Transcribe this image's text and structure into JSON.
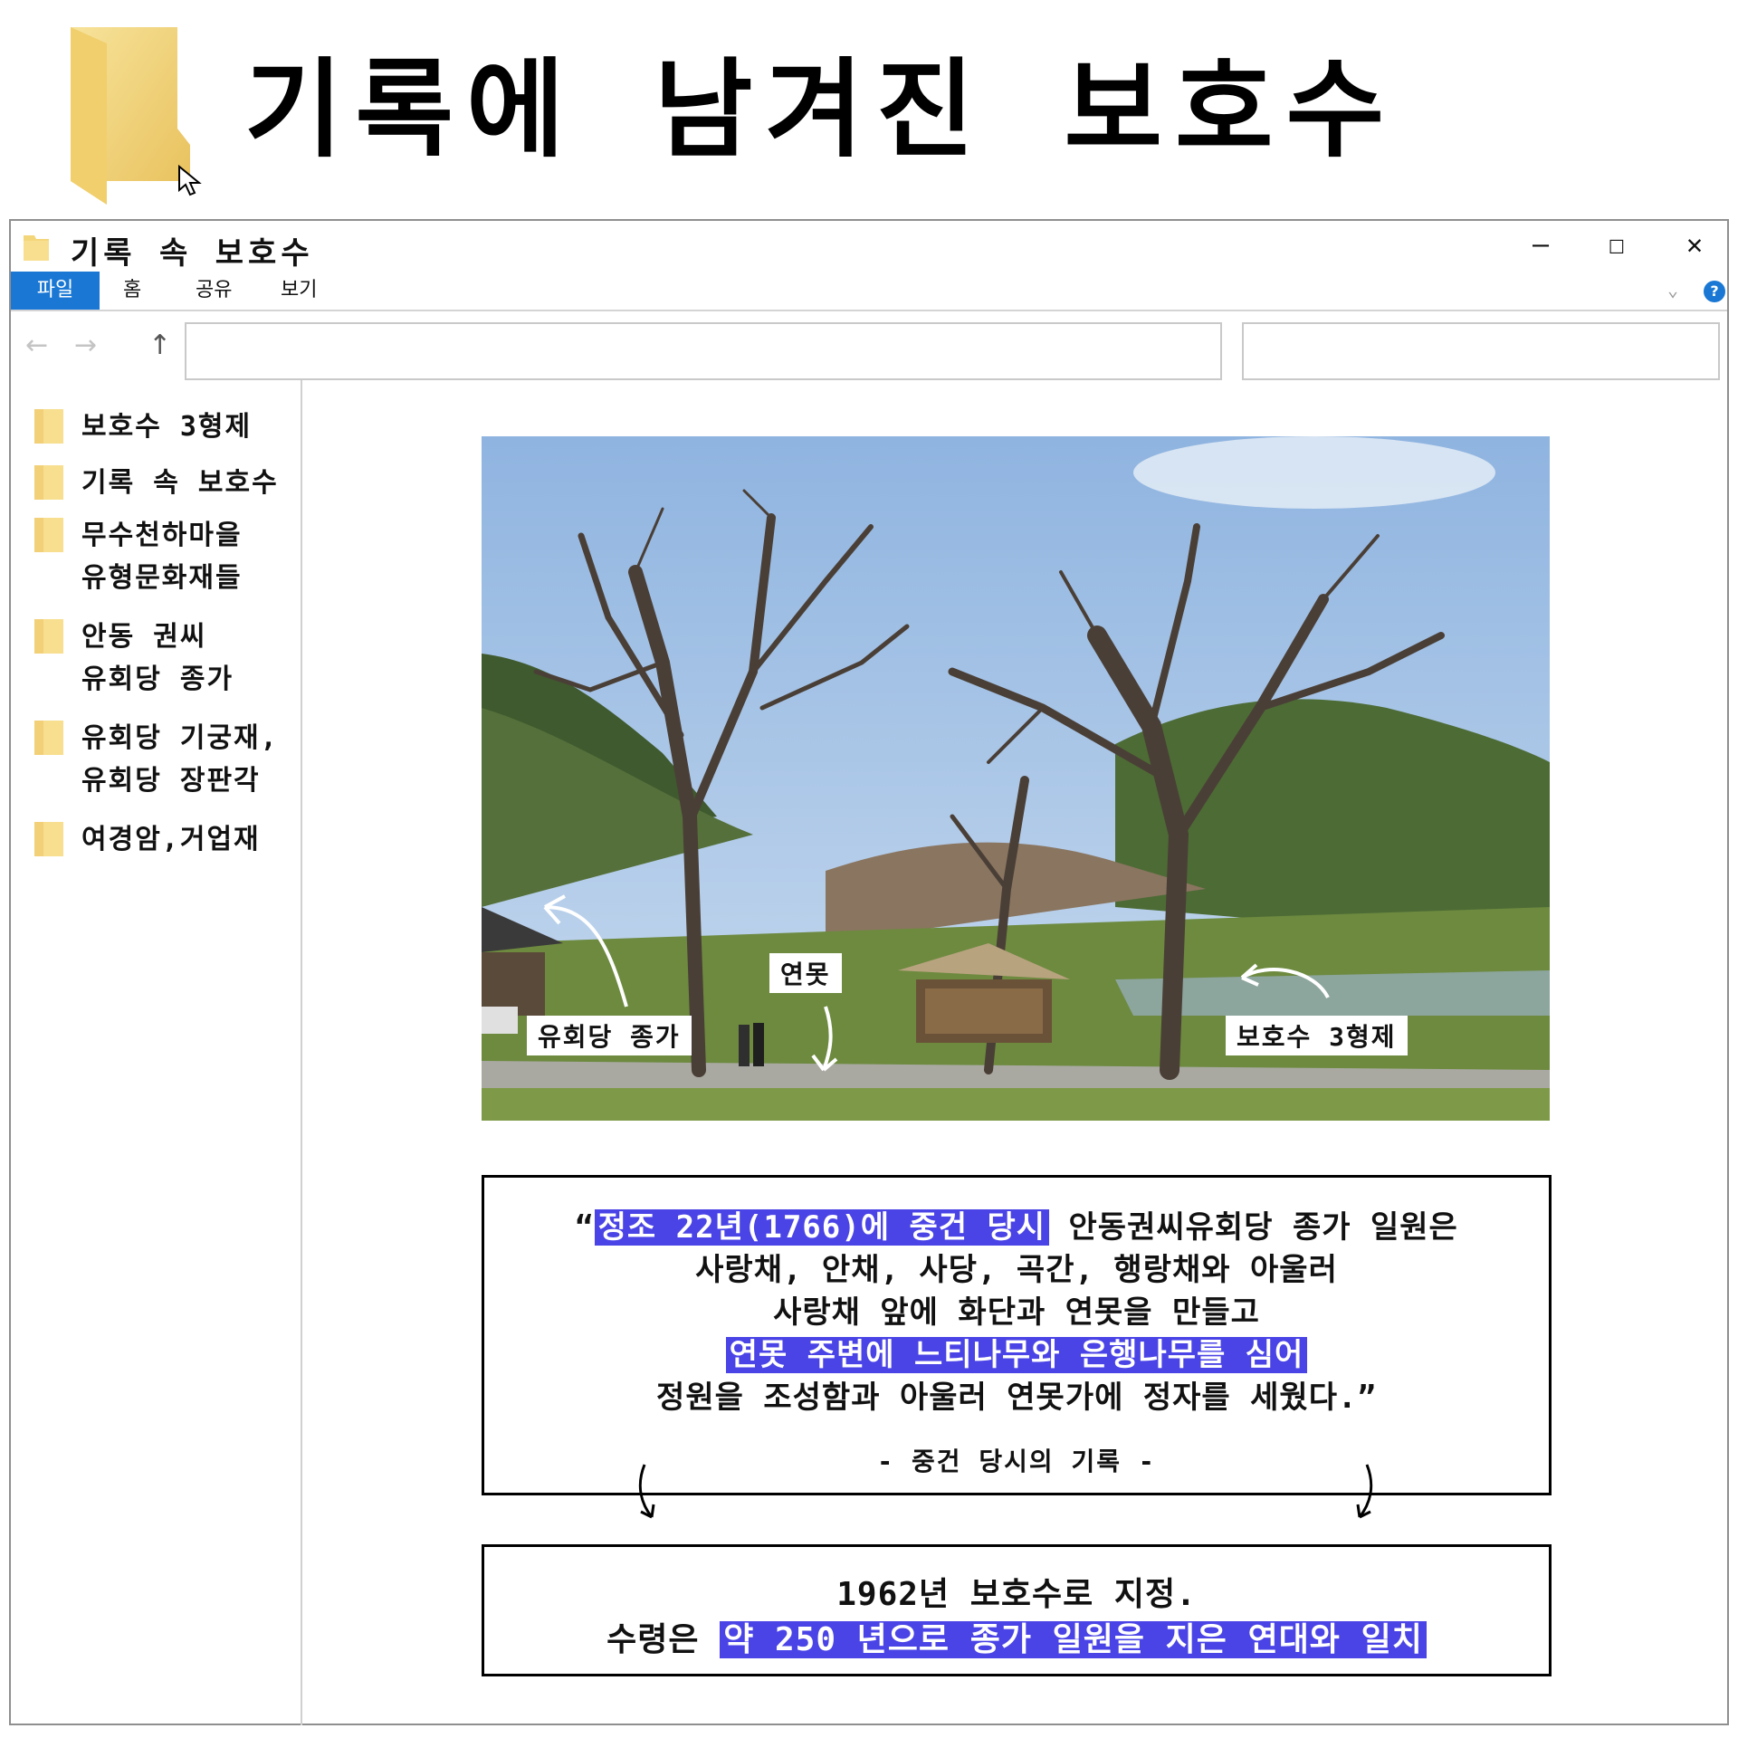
{
  "header": {
    "title": "기록에 남겨진 보호수",
    "folder_icon": "folder-icon",
    "cursor_icon": "mouse-cursor-icon"
  },
  "window": {
    "title": "기록 속 보호수",
    "controls": {
      "minimize": "—",
      "maximize": "☐",
      "close": "✕"
    }
  },
  "ribbon": {
    "tabs": [
      "파일",
      "홈",
      "공유",
      "보기"
    ],
    "help": "?"
  },
  "nav": {
    "back": "←",
    "forward": "→",
    "up": "↑"
  },
  "sidebar": {
    "items": [
      {
        "label": "보호수 3형제"
      },
      {
        "label": "기록 속 보호수"
      },
      {
        "label": "무수천하마을\n유형문화재들"
      },
      {
        "label": "안동 권씨\n유회당 종가"
      },
      {
        "label": "유회당 기궁재,\n유회당 장판각"
      },
      {
        "label": "여경암,거업재"
      }
    ]
  },
  "photo": {
    "labels": {
      "jongga": "유회당 종가",
      "pond": "연못",
      "trees": "보호수 3형제"
    }
  },
  "record": {
    "open_quote": "“",
    "line1_hl": "정조 22년(1766)에 중건 당시",
    "line1_rest": " 안동권씨유회당 종가 일원은",
    "line2": "사랑채, 안채, 사당, 곡간, 행랑채와 아울러",
    "line3": "사랑채 앞에 화단과 연못을 만들고",
    "line4_hl": "연못 주변에 느티나무와 은행나무를 심어",
    "line5": "정원을 조성함과 아울러 연못가에 정자를 세웠다.”",
    "source": "- 중건 당시의 기록 -"
  },
  "result": {
    "line1": "1962년 보호수로 지정.",
    "line2_prefix": "수령은 ",
    "line2_hl": "약 250 년으로 종가 일원을 지은 연대와 일치"
  },
  "colors": {
    "highlight": "#4a43e6",
    "ribbon_accent": "#1a78d4",
    "folder": "#f4d67a"
  }
}
